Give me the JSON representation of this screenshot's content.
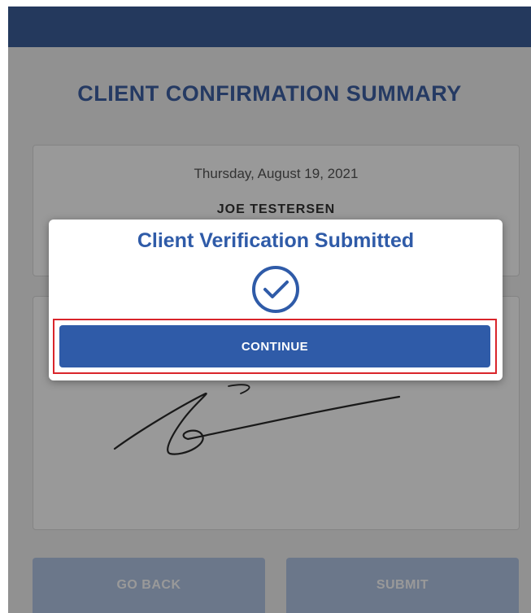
{
  "page": {
    "title": "CLIENT CONFIRMATION SUMMARY"
  },
  "summary": {
    "date": "Thursday, August 19, 2021",
    "client_name": "JOE TESTERSEN"
  },
  "actions": {
    "go_back_label": "GO BACK",
    "submit_label": "SUBMIT"
  },
  "modal": {
    "title": "Client Verification Submitted",
    "icon": "check-circle-icon",
    "continue_label": "CONTINUE"
  },
  "colors": {
    "header": "#3d5f9c",
    "accent": "#2f5ba8",
    "title": "#3e62a6",
    "highlight": "#d9252b"
  }
}
